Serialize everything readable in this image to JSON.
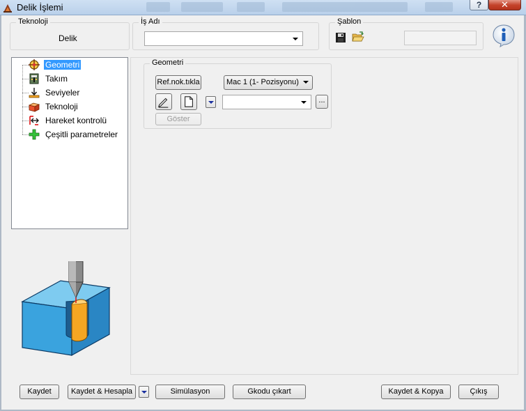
{
  "window": {
    "title": "Delik İşlemi",
    "help_label": "?",
    "close_label": "✕"
  },
  "teknoloji": {
    "label": "Teknoloji",
    "value": "Delik"
  },
  "is_adi": {
    "label": "İş Adı",
    "value": ""
  },
  "sablon": {
    "label": "Şablon",
    "save_icon": "save-icon",
    "open_icon": "open-folder-icon",
    "field_value": ""
  },
  "info_icon": "info-icon",
  "tree": {
    "items": [
      {
        "label": "Geometri",
        "icon": "geometry-crosshair-icon",
        "selected": true
      },
      {
        "label": "Takım",
        "icon": "tool-icon",
        "selected": false
      },
      {
        "label": "Seviyeler",
        "icon": "levels-arrow-icon",
        "selected": false
      },
      {
        "label": "Teknoloji",
        "icon": "technology-cube-icon",
        "selected": false
      },
      {
        "label": "Hareket kontrolü",
        "icon": "motion-control-icon",
        "selected": false
      },
      {
        "label": "Çeşitli parametreler",
        "icon": "plus-icon",
        "selected": false
      }
    ]
  },
  "geometry_group": {
    "label": "Geometri",
    "ref_button": "Ref.nok.tıkla",
    "position_select": "Mac 1 (1- Pozisyonu)",
    "geometry_select": "",
    "browse_button": "...",
    "show_button": "Göster"
  },
  "footer": {
    "kaydet": "Kaydet",
    "kaydet_hesapla": "Kaydet & Hesapla",
    "simulasyon": "Simülasyon",
    "gkodu": "Gkodu çıkart",
    "kaydet_kopya": "Kaydet & Kopya",
    "cikis": "Çıkış"
  },
  "colors": {
    "selection": "#3399ff",
    "block_blue": "#3aa3de",
    "hole_orange": "#f5a623",
    "info_blue": "#1f5fb8"
  }
}
